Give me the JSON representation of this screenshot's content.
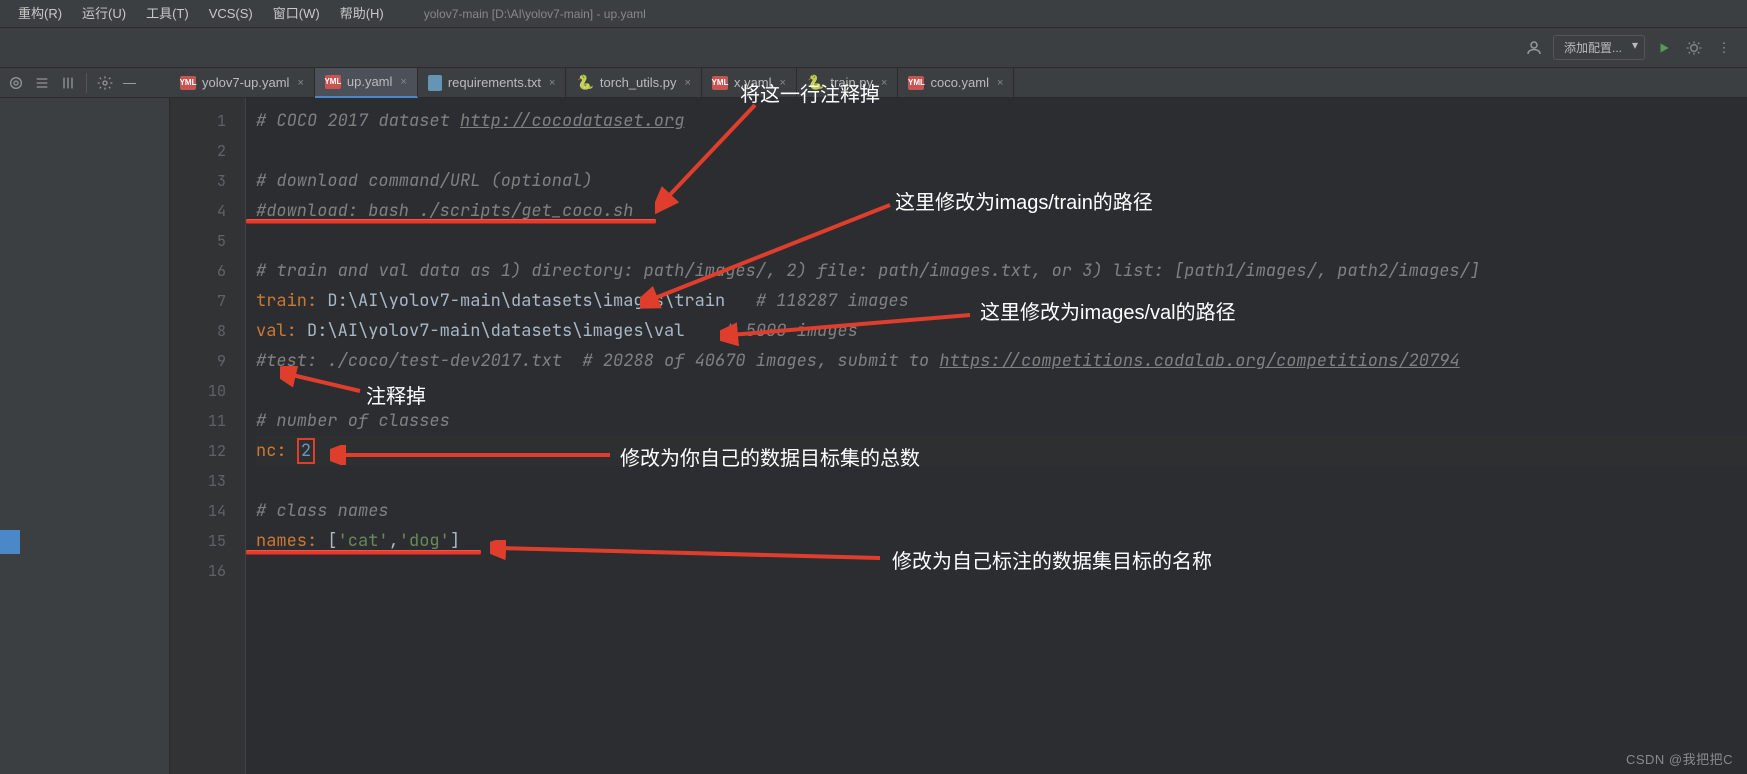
{
  "menu": {
    "items": [
      "重构(R)",
      "运行(U)",
      "工具(T)",
      "VCS(S)",
      "窗口(W)",
      "帮助(H)"
    ],
    "title": "yolov7-main [D:\\AI\\yolov7-main] - up.yaml"
  },
  "toolbar": {
    "config_label": "添加配置..."
  },
  "tabs": [
    {
      "icon": "yml",
      "label": "yolov7-up.yaml",
      "active": false
    },
    {
      "icon": "yml",
      "label": "up.yaml",
      "active": true
    },
    {
      "icon": "txt",
      "label": "requirements.txt",
      "active": false
    },
    {
      "icon": "py",
      "label": "torch_utils.py",
      "active": false
    },
    {
      "icon": "yml",
      "label": "x.yaml",
      "active": false
    },
    {
      "icon": "py",
      "label": "train.py",
      "active": false
    },
    {
      "icon": "yml",
      "label": "coco.yaml",
      "active": false
    }
  ],
  "gutter": {
    "start": 1,
    "end": 16
  },
  "code": {
    "l1_comment": "# COCO 2017 dataset ",
    "l1_link": "http://cocodataset.org",
    "l3": "# download command/URL (optional)",
    "l4": "#download: bash ./scripts/get_coco.sh",
    "l6": "# train and val data as 1) directory: path/images/, 2) file: path/images.txt, or 3) list: [path1/images/, path2/images/]",
    "l7_key": "train",
    "l7_val": "D:\\AI\\yolov7-main\\datasets\\images\\train",
    "l7_tail": "   # 118287 images",
    "l8_key": "val",
    "l8_val": "D:\\AI\\yolov7-main\\datasets\\images\\val",
    "l8_tail": "    # 5000 images",
    "l9a": "#test: ./coco/test-dev2017.txt  # 20288 of 40670 images, submit to ",
    "l9b": "https://competitions.codalab.org/competitions/20794",
    "l11": "# number of classes",
    "l12_key": "nc",
    "l12_val": "2",
    "l14": "# class names",
    "l15_key": "names",
    "l15_open": "[",
    "l15_s1": "'cat'",
    "l15_comma": ",",
    "l15_s2": "'dog'",
    "l15_close": "]"
  },
  "annotations": {
    "a1": "将这一行注释掉",
    "a2": "这里修改为imags/train的路径",
    "a3": "这里修改为images/val的路径",
    "a4": "注释掉",
    "a5": "修改为你自己的数据目标集的总数",
    "a6": "修改为自己标注的数据集目标的名称"
  },
  "watermark": "CSDN @我把把C"
}
